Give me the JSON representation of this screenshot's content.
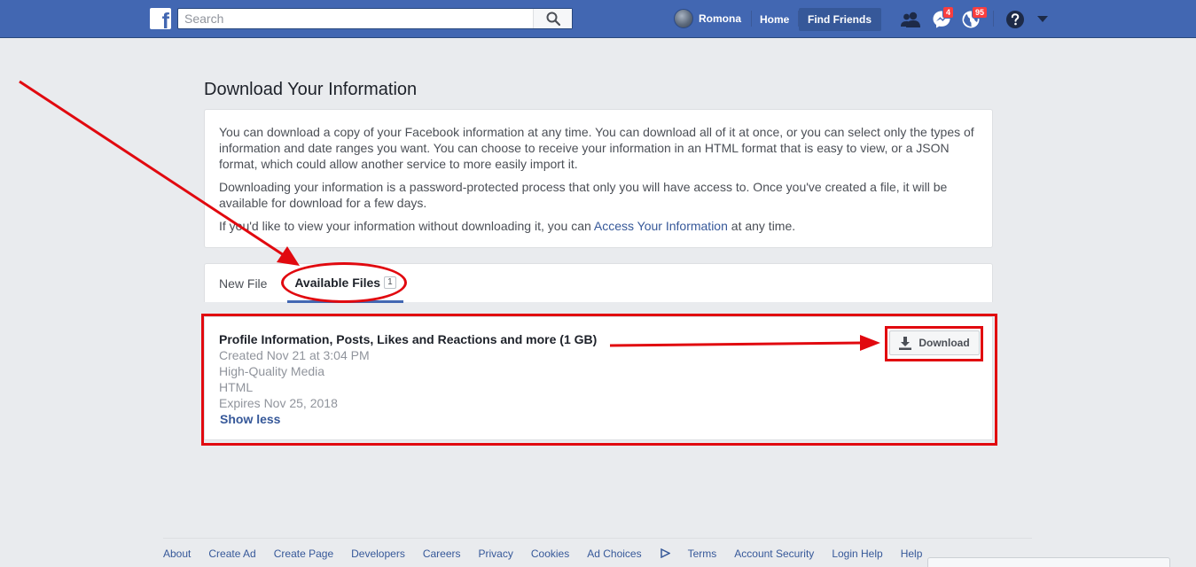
{
  "topbar": {
    "search_placeholder": "Search",
    "user_name": "Romona",
    "home_label": "Home",
    "find_friends_label": "Find Friends",
    "messages_badge": "4",
    "notifications_badge": "95"
  },
  "page": {
    "title": "Download Your Information",
    "intro_p1": "You can download a copy of your Facebook information at any time. You can download all of it at once, or you can select only the types of information and date ranges you want. You can choose to receive your information in an HTML format that is easy to view, or a JSON format, which could allow another service to more easily import it.",
    "intro_p2": "Downloading your information is a password-protected process that only you will have access to. Once you've created a file, it will be available for download for a few days.",
    "intro_p3_before": "If you'd like to view your information without downloading it, you can ",
    "intro_p3_link": "Access Your Information",
    "intro_p3_after": " at any time."
  },
  "tabs": {
    "new_file": "New File",
    "available_files": "Available Files",
    "available_count": "1"
  },
  "file": {
    "title": "Profile Information, Posts, Likes and Reactions and more (1 GB)",
    "created": "Created Nov 21 at 3:04 PM",
    "quality": "High-Quality Media",
    "format": "HTML",
    "expires": "Expires Nov 25, 2018",
    "show_less": "Show less",
    "download_label": "Download"
  },
  "footer": {
    "links": [
      "About",
      "Create Ad",
      "Create Page",
      "Developers",
      "Careers",
      "Privacy",
      "Cookies",
      "Ad Choices",
      "Terms",
      "Account Security",
      "Login Help",
      "Help"
    ]
  },
  "colors": {
    "brand_blue": "#4267b2",
    "annotation_red": "#e1090f",
    "link_blue": "#365899"
  }
}
